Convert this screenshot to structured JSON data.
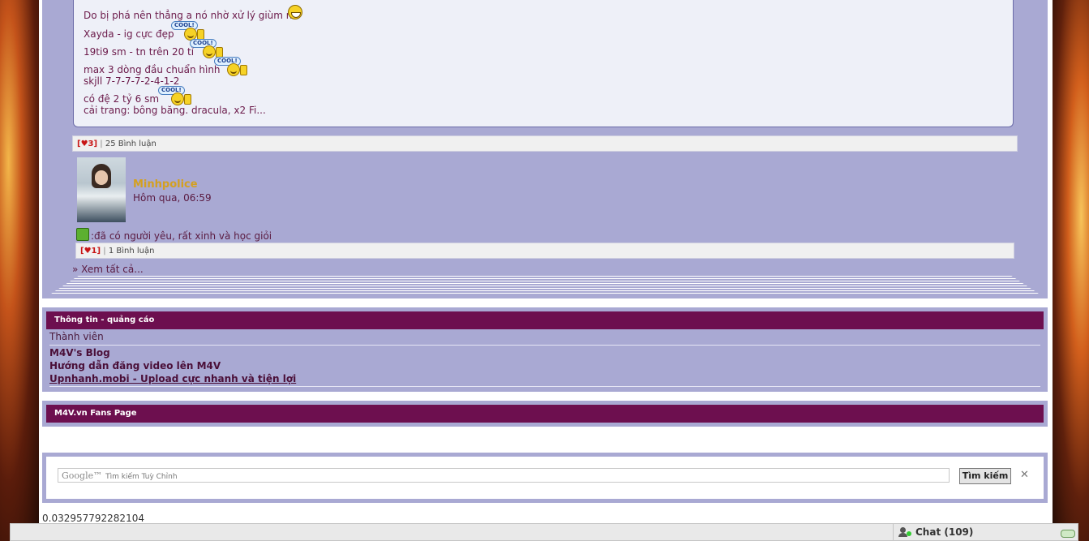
{
  "post": {
    "lines": [
      "Do bị phá nên thẳng a nó nhờ xử lý giùm nó",
      "Xayda - ig cực đẹp",
      "19ti9 sm - tn trên 20 tỉ",
      "max 3 dòng đầu chuẩn hình",
      "skjll 7-7-7-7-2-4-1-2",
      "có đệ 2 tỷ 6 sm",
      "cải trang: bông băng. dracula, x2 Fi..."
    ],
    "cool_label": "COOL!",
    "likes": "[♥3]",
    "sep": "|",
    "comments": "25 Bình luận"
  },
  "status_post": {
    "username": "Minhpolice",
    "time": "Hôm qua, 06:59",
    "text": ":đã có người yêu, rất xinh và học giỏi",
    "likes": "[♥1]",
    "sep": "|",
    "comments": "1 Bình luận"
  },
  "see_all": "» Xem tất cả...",
  "info_section": {
    "title": "Thông tin - quảng cáo",
    "subtitle": "Thành viên",
    "links": [
      "M4V's Blog",
      "Hướng dẫn đăng video lên M4V",
      "Upnhanh.mobi - Upload cực nhanh và tiện lợi"
    ]
  },
  "fans_section": {
    "title": "M4V.vn Fans Page"
  },
  "search": {
    "logo": "Google™",
    "placeholder": "Tìm kiếm Tuỳ Chỉnh",
    "button": "Tìm kiếm",
    "clear": "✕"
  },
  "stat_value": "0.032957792282104",
  "chat": {
    "label": "Chat",
    "count": "(109)"
  },
  "colors": {
    "panel": "#a9a9d3",
    "header": "#6d0f4f",
    "username": "#d4a020"
  }
}
